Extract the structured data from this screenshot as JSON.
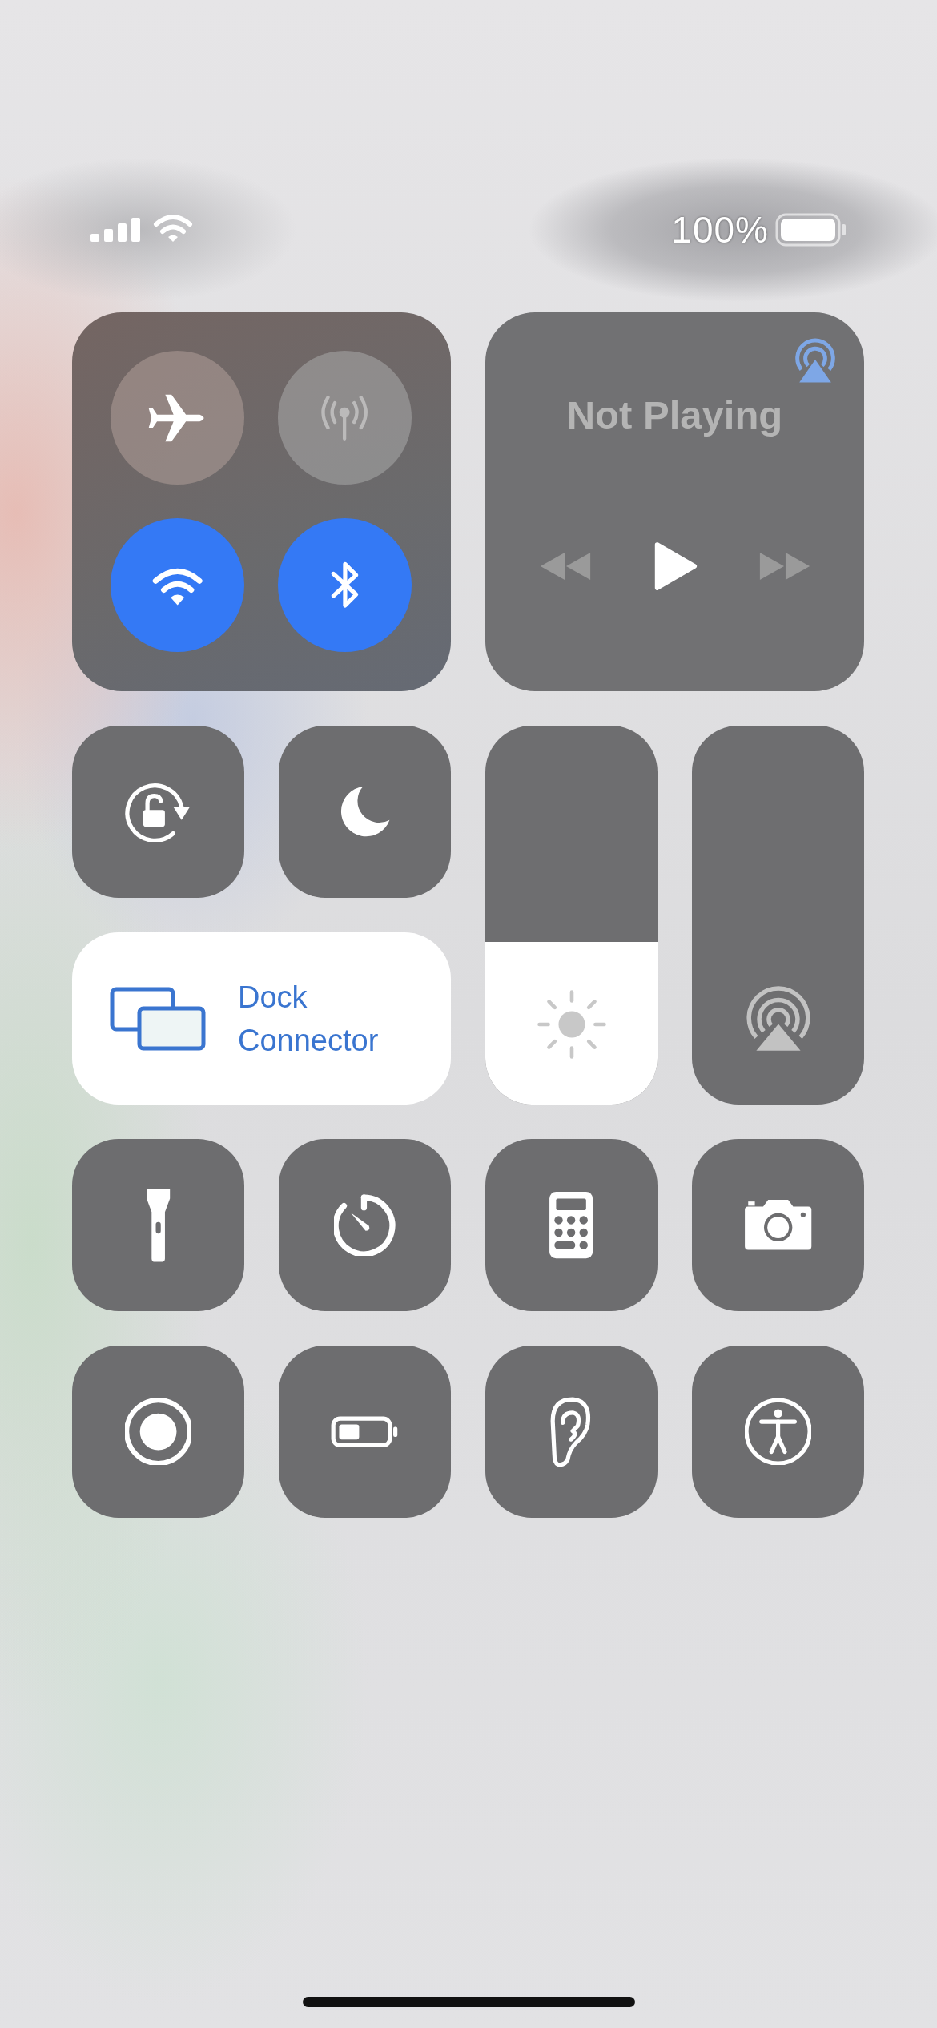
{
  "status_bar": {
    "battery_percent": "100%"
  },
  "connectivity": [
    {
      "kind": "airplane",
      "on": false,
      "disabled": false
    },
    {
      "kind": "cellular",
      "on": false,
      "disabled": true
    },
    {
      "kind": "wifi",
      "on": true,
      "disabled": false
    },
    {
      "kind": "bluetooth",
      "on": true,
      "disabled": false
    }
  ],
  "media": {
    "title": "Not Playing"
  },
  "toggles": [
    {
      "kind": "rotation-lock",
      "on": false
    },
    {
      "kind": "moon",
      "on": false
    }
  ],
  "screen_mirroring": {
    "label": "Dock Connector",
    "on": true
  },
  "brightness": {
    "level": 0.43
  },
  "volume": {
    "level": 0
  },
  "shortcuts": [
    {
      "kind": "flashlight"
    },
    {
      "kind": "timer"
    },
    {
      "kind": "calculator"
    },
    {
      "kind": "camera"
    },
    {
      "kind": "screen-record"
    },
    {
      "kind": "low-power"
    },
    {
      "kind": "hearing"
    },
    {
      "kind": "accessibility"
    }
  ]
}
